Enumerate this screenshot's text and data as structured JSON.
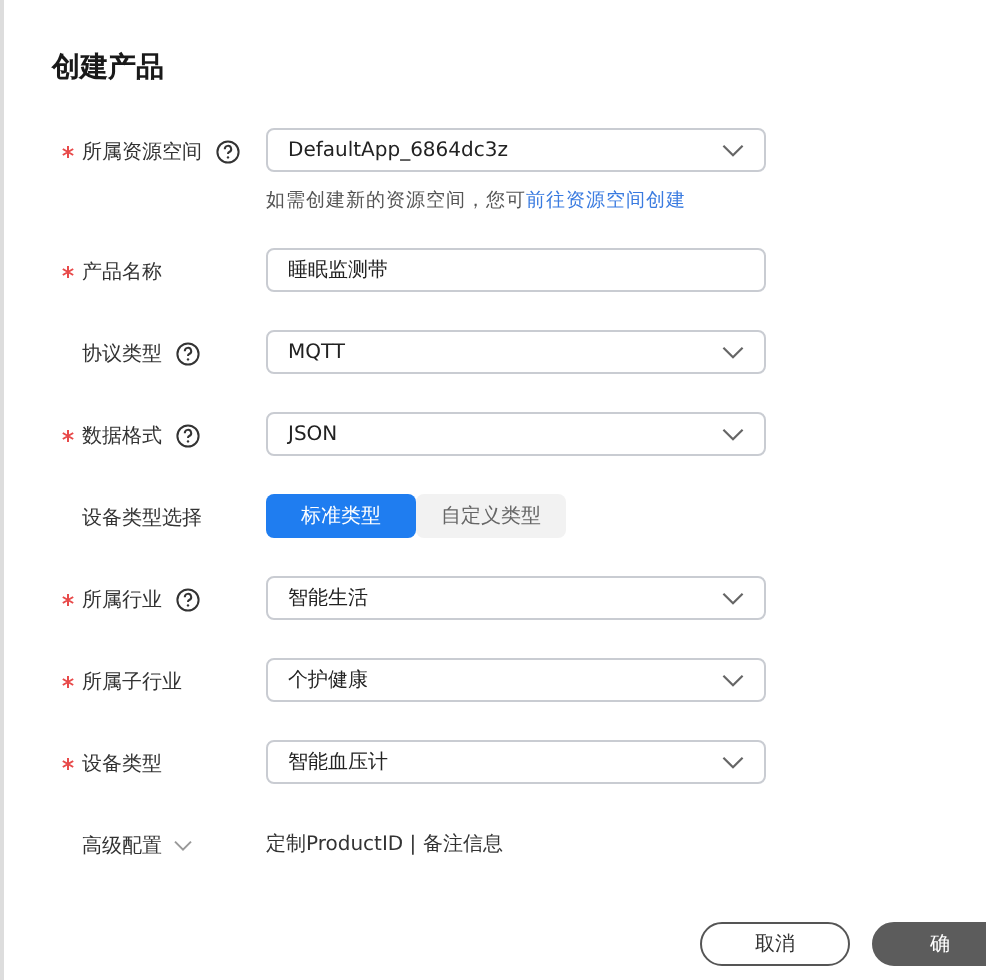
{
  "title": "创建产品",
  "fields": [
    {
      "kind": "select",
      "label": "所属资源空间",
      "required": true,
      "help": true,
      "value": "DefaultApp_6864dc3z",
      "hint": "如需创建新的资源空间，您可",
      "hint_link": "前往资源空间创建"
    },
    {
      "kind": "input",
      "label": "产品名称",
      "required": true,
      "help": false,
      "value": "睡眠监测带"
    },
    {
      "kind": "select",
      "label": "协议类型",
      "required": false,
      "help": true,
      "value": "MQTT"
    },
    {
      "kind": "select",
      "label": "数据格式",
      "required": true,
      "help": true,
      "value": "JSON"
    },
    {
      "kind": "toggle",
      "label": "设备类型选择",
      "required": false,
      "help": false,
      "options": [
        {
          "label": "标准类型",
          "selected": true
        },
        {
          "label": "自定义类型",
          "selected": false
        }
      ]
    },
    {
      "kind": "select",
      "label": "所属行业",
      "required": true,
      "help": true,
      "value": "智能生活"
    },
    {
      "kind": "select",
      "label": "所属子行业",
      "required": true,
      "help": false,
      "value": "个护健康"
    },
    {
      "kind": "select",
      "label": "设备类型",
      "required": true,
      "help": false,
      "value": "智能血压计"
    },
    {
      "kind": "advanced",
      "label": "高级配置",
      "required": false,
      "help": false,
      "value": "定制ProductID | 备注信息"
    }
  ],
  "buttons": [
    {
      "label": "取消",
      "kind": "secondary"
    },
    {
      "label": "确",
      "kind": "primary"
    }
  ]
}
